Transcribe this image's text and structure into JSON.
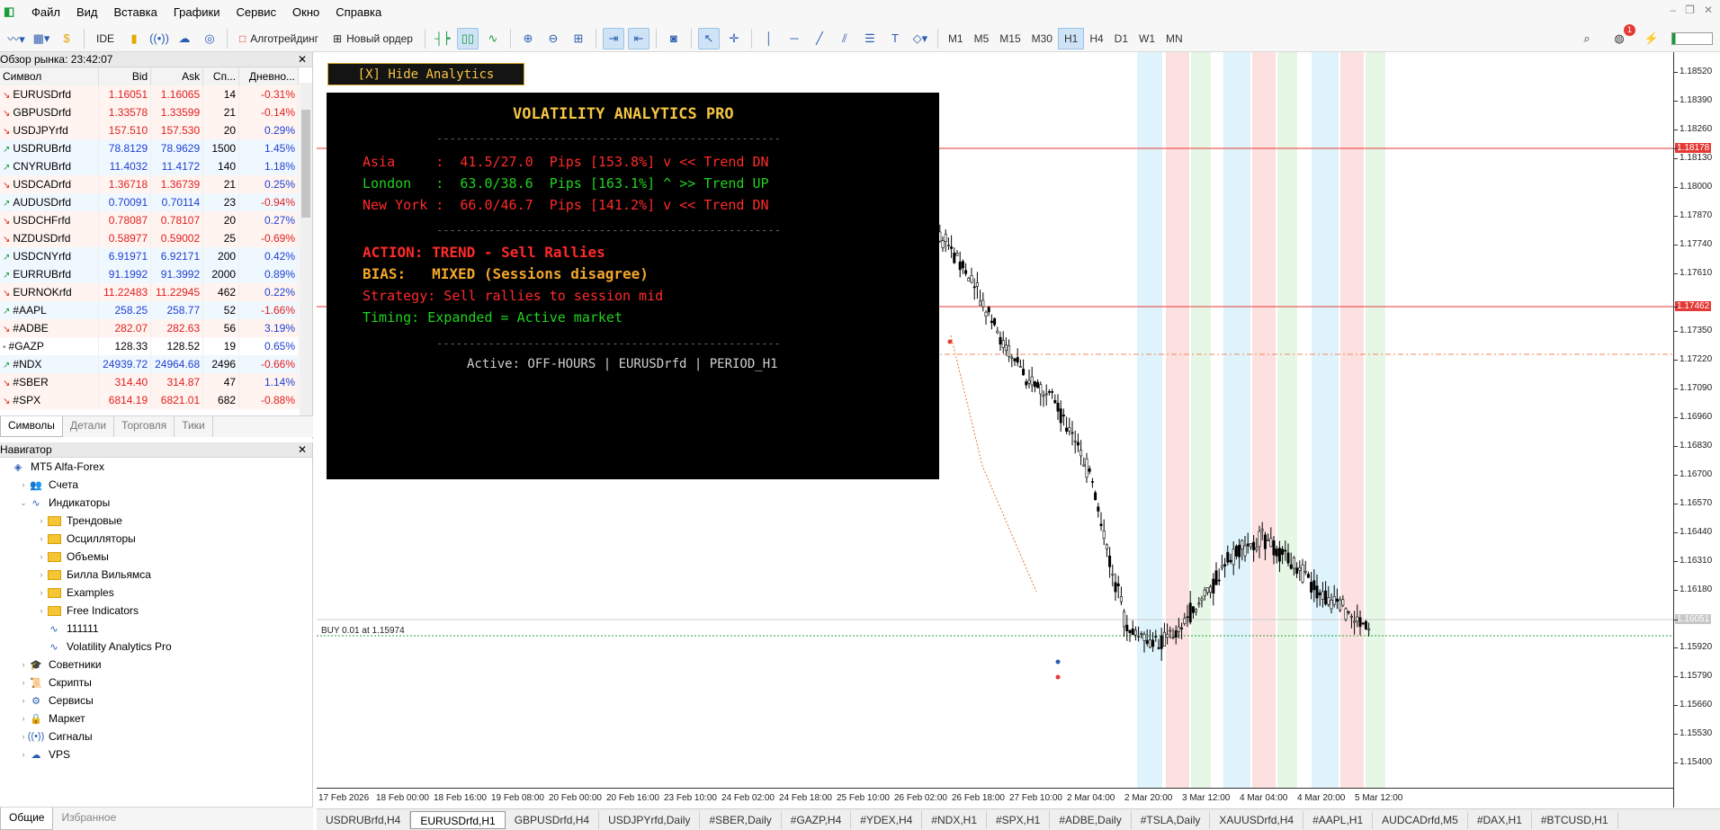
{
  "menu": [
    "Файл",
    "Вид",
    "Вставка",
    "Графики",
    "Сервис",
    "Окно",
    "Справка"
  ],
  "toolbar": {
    "ide_label": "IDE",
    "algo_label": "Алготрейдинг",
    "new_order_label": "Новый ордер",
    "timeframes": [
      "M1",
      "M5",
      "M15",
      "M30",
      "H1",
      "H4",
      "D1",
      "W1",
      "MN"
    ],
    "active_timeframe": "H1",
    "notif_count": "1"
  },
  "market_watch": {
    "title": "Обзор рынка: 23:42:07",
    "columns": [
      "Символ",
      "Bid",
      "Ask",
      "Сп...",
      "Дневно..."
    ],
    "rows": [
      {
        "symbol": "EURUSDrfd",
        "bid": "1.16051",
        "ask": "1.16065",
        "spread": "14",
        "change": "-0.31%",
        "dir": "dn"
      },
      {
        "symbol": "GBPUSDrfd",
        "bid": "1.33578",
        "ask": "1.33599",
        "spread": "21",
        "change": "-0.14%",
        "dir": "dn"
      },
      {
        "symbol": "USDJPYrfd",
        "bid": "157.510",
        "ask": "157.530",
        "spread": "20",
        "change": "0.29%",
        "dir": "dn"
      },
      {
        "symbol": "USDRUBrfd",
        "bid": "78.8129",
        "ask": "78.9629",
        "spread": "1500",
        "change": "1.45%",
        "dir": "up"
      },
      {
        "symbol": "CNYRUBrfd",
        "bid": "11.4032",
        "ask": "11.4172",
        "spread": "140",
        "change": "1.18%",
        "dir": "up"
      },
      {
        "symbol": "USDCADrfd",
        "bid": "1.36718",
        "ask": "1.36739",
        "spread": "21",
        "change": "0.25%",
        "dir": "dn"
      },
      {
        "symbol": "AUDUSDrfd",
        "bid": "0.70091",
        "ask": "0.70114",
        "spread": "23",
        "change": "-0.94%",
        "dir": "up"
      },
      {
        "symbol": "USDCHFrfd",
        "bid": "0.78087",
        "ask": "0.78107",
        "spread": "20",
        "change": "0.27%",
        "dir": "dn"
      },
      {
        "symbol": "NZDUSDrfd",
        "bid": "0.58977",
        "ask": "0.59002",
        "spread": "25",
        "change": "-0.69%",
        "dir": "dn"
      },
      {
        "symbol": "USDCNYrfd",
        "bid": "6.91971",
        "ask": "6.92171",
        "spread": "200",
        "change": "0.42%",
        "dir": "up"
      },
      {
        "symbol": "EURRUBrfd",
        "bid": "91.1992",
        "ask": "91.3992",
        "spread": "2000",
        "change": "0.89%",
        "dir": "up"
      },
      {
        "symbol": "EURNOKrfd",
        "bid": "11.22483",
        "ask": "11.22945",
        "spread": "462",
        "change": "0.22%",
        "dir": "dn"
      },
      {
        "symbol": "#AAPL",
        "bid": "258.25",
        "ask": "258.77",
        "spread": "52",
        "change": "-1.66%",
        "dir": "up"
      },
      {
        "symbol": "#ADBE",
        "bid": "282.07",
        "ask": "282.63",
        "spread": "56",
        "change": "3.19%",
        "dir": "dn"
      },
      {
        "symbol": "#GAZP",
        "bid": "128.33",
        "ask": "128.52",
        "spread": "19",
        "change": "0.65%",
        "dir": "flat"
      },
      {
        "symbol": "#NDX",
        "bid": "24939.72",
        "ask": "24964.68",
        "spread": "2496",
        "change": "-0.66%",
        "dir": "up"
      },
      {
        "symbol": "#SBER",
        "bid": "314.40",
        "ask": "314.87",
        "spread": "47",
        "change": "1.14%",
        "dir": "dn"
      },
      {
        "symbol": "#SPX",
        "bid": "6814.19",
        "ask": "6821.01",
        "spread": "682",
        "change": "-0.88%",
        "dir": "dn"
      }
    ],
    "tabs": [
      "Символы",
      "Детали",
      "Торговля",
      "Тики"
    ]
  },
  "navigator": {
    "title": "Навигатор",
    "items": [
      {
        "label": "MT5 Alfa-Forex",
        "depth": 0,
        "type": "root"
      },
      {
        "label": "Счета",
        "depth": 1,
        "type": "accounts"
      },
      {
        "label": "Индикаторы",
        "depth": 1,
        "type": "indicators"
      },
      {
        "label": "Трендовые",
        "depth": 2,
        "type": "folder"
      },
      {
        "label": "Осцилляторы",
        "depth": 2,
        "type": "folder"
      },
      {
        "label": "Объемы",
        "depth": 2,
        "type": "folder"
      },
      {
        "label": "Билла Вильямса",
        "depth": 2,
        "type": "folder"
      },
      {
        "label": "Examples",
        "depth": 2,
        "type": "folder"
      },
      {
        "label": "Free Indicators",
        "depth": 2,
        "type": "folder"
      },
      {
        "label": "111111",
        "depth": 2,
        "type": "indicator"
      },
      {
        "label": "Volatility Analytics Pro",
        "depth": 2,
        "type": "indicator"
      },
      {
        "label": "Советники",
        "depth": 1,
        "type": "experts"
      },
      {
        "label": "Скрипты",
        "depth": 1,
        "type": "scripts"
      },
      {
        "label": "Сервисы",
        "depth": 1,
        "type": "services"
      },
      {
        "label": "Маркет",
        "depth": 1,
        "type": "market"
      },
      {
        "label": "Сигналы",
        "depth": 1,
        "type": "signals"
      },
      {
        "label": "VPS",
        "depth": 1,
        "type": "vps"
      }
    ],
    "bottom_tabs": [
      "Общие",
      "Избранное"
    ]
  },
  "chart": {
    "hide_button": "[X] Hide Analytics",
    "trade_line_label": "BUY 0.01 at 1.15974",
    "price_labels": [
      "1.18520",
      "1.18390",
      "1.18260",
      "1.18178",
      "1.18130",
      "1.18000",
      "1.17870",
      "1.17740",
      "1.17610",
      "1.17462",
      "1.17350",
      "1.17220",
      "1.17090",
      "1.16960",
      "1.16830",
      "1.16700",
      "1.16570",
      "1.16440",
      "1.16310",
      "1.16180",
      "1.16051",
      "1.15920",
      "1.15790",
      "1.15660",
      "1.15530",
      "1.15400"
    ],
    "time_labels": [
      "17 Feb 2026",
      "18 Feb 00:00",
      "18 Feb 16:00",
      "19 Feb 08:00",
      "20 Feb 00:00",
      "20 Feb 16:00",
      "23 Feb 10:00",
      "24 Feb 02:00",
      "24 Feb 18:00",
      "25 Feb 10:00",
      "26 Feb 02:00",
      "26 Feb 18:00",
      "27 Feb 10:00",
      "2 Mar 04:00",
      "2 Mar 20:00",
      "3 Mar 12:00",
      "4 Mar 04:00",
      "4 Mar 20:00",
      "5 Mar 12:00"
    ],
    "colors": {
      "red_line": "#e53935",
      "trade_line": "#2e9e3a",
      "session_blue": "#dff3fc",
      "session_red": "#fde0e0",
      "session_green": "#e6f7e6"
    }
  },
  "analytics": {
    "title": "VOLATILITY ANALYTICS PRO",
    "divider": "-----------------------------------------------------",
    "sessions": [
      {
        "text": "Asia     :  41.5/27.0  Pips [153.8%] v << Trend DN",
        "color": "#ff2a2a"
      },
      {
        "text": "London   :  63.0/38.6  Pips [163.1%] ^ >> Trend UP",
        "color": "#1fd31f"
      },
      {
        "text": "New York :  66.0/46.7  Pips [141.2%] v << Trend DN",
        "color": "#ff2a2a"
      }
    ],
    "action": "ACTION: TREND - Sell Rallies",
    "bias": "BIAS:   MIXED (Sessions disagree)",
    "strategy": "Strategy: Sell rallies to session mid",
    "timing": "Timing: Expanded = Active market",
    "footer": "Active: OFF-HOURS | EURUSDrfd | PERIOD_H1"
  },
  "chart_tabs": [
    "USDRUBrfd,H4",
    "EURUSDrfd,H1",
    "GBPUSDrfd,H4",
    "USDJPYrfd,Daily",
    "#SBER,Daily",
    "#GAZP,H4",
    "#YDEX,H4",
    "#NDX,H1",
    "#SPX,H1",
    "#ADBE,Daily",
    "#TSLA,Daily",
    "XAUUSDrfd,H4",
    "#AAPL,H1",
    "AUDCADrfd,M5",
    "#DAX,H1",
    "#BTCUSD,H1"
  ],
  "active_chart_tab": "EURUSDrfd,H1"
}
